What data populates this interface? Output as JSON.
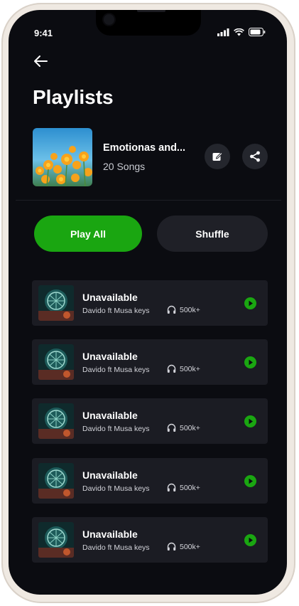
{
  "status_bar": {
    "time": "9:41"
  },
  "header": {
    "title": "Playlists"
  },
  "playlist": {
    "name": "Emotionas and...",
    "song_count": "20 Songs"
  },
  "actions": {
    "play_all": "Play All",
    "shuffle": "Shuffle"
  },
  "tracks": [
    {
      "title": "Unavailable",
      "artist": "Davido ft Musa keys",
      "listens": "500k+"
    },
    {
      "title": "Unavailable",
      "artist": "Davido ft Musa keys",
      "listens": "500k+"
    },
    {
      "title": "Unavailable",
      "artist": "Davido ft Musa keys",
      "listens": "500k+"
    },
    {
      "title": "Unavailable",
      "artist": "Davido ft Musa keys",
      "listens": "500k+"
    },
    {
      "title": "Unavailable",
      "artist": "Davido ft Musa keys",
      "listens": "500k+"
    }
  ],
  "colors": {
    "accent": "#1aa611",
    "background": "#0b0c11",
    "card": "#1b1c23"
  },
  "icons": [
    "back-arrow-icon",
    "edit-icon",
    "share-icon",
    "headphones-icon",
    "play-icon",
    "signal-icon",
    "wifi-icon",
    "battery-icon"
  ]
}
